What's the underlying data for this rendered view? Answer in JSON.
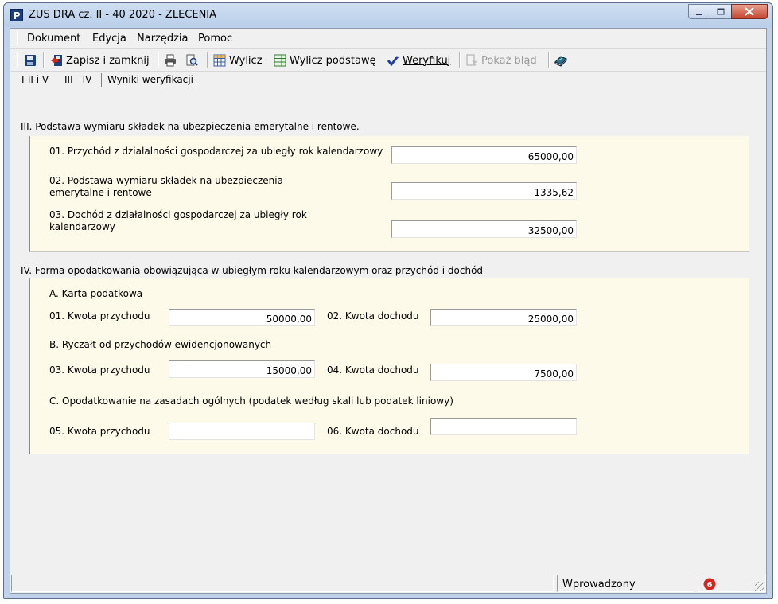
{
  "window": {
    "title": "ZUS DRA cz. II - 40 2020 - ZLECENIA",
    "app_icon_letter": "P"
  },
  "menu": [
    "Dokument",
    "Edycja",
    "Narzędzia",
    "Pomoc"
  ],
  "toolbar": {
    "save_close": "Zapisz i zamknij",
    "calculate": "Wylicz",
    "calculate_base": "Wylicz podstawę",
    "verify": "Weryfikuj",
    "show_error": "Pokaż błąd"
  },
  "tabs": [
    "I-II i V",
    "III - IV",
    "Wyniki weryfikacji"
  ],
  "section3": {
    "title": "III. Podstawa wymiaru składek na ubezpieczenia emerytalne i rentowe.",
    "rows": [
      {
        "label": "01. Przychód z działalności gospodarczej za ubiegły rok kalendarzowy",
        "value": "65000,00"
      },
      {
        "label_line1": "02. Podstawa wymiaru składek na ubezpieczenia",
        "label_line2": "emerytalne i rentowe",
        "value": "1335,62"
      },
      {
        "label_line1": "03. Dochód z działalności gospodarczej za ubiegły rok",
        "label_line2": "kalendarzowy",
        "value": "32500,00"
      }
    ]
  },
  "section4": {
    "title": "IV. Forma opodatkowania obowiązująca w ubiegłym roku kalendarzowym oraz przychód i dochód",
    "groups": [
      {
        "title": "A. Karta podatkowa",
        "income_label": "01. Kwota przychodu",
        "income": "50000,00",
        "profit_label": "02. Kwota dochodu",
        "profit": "25000,00"
      },
      {
        "title": "B. Ryczałt od przychodów ewidencjonowanych",
        "income_label": "03. Kwota przychodu",
        "income": "15000,00",
        "profit_label": "04. Kwota dochodu",
        "profit": "7500,00"
      },
      {
        "title": "C. Opodatkowanie na zasadach ogólnych (podatek według skali lub podatek liniowy)",
        "income_label": "05. Kwota przychodu",
        "income": "",
        "profit_label": "06. Kwota dochodu",
        "profit": ""
      }
    ]
  },
  "status": {
    "state": "Wprowadzony",
    "error_count": "6"
  }
}
